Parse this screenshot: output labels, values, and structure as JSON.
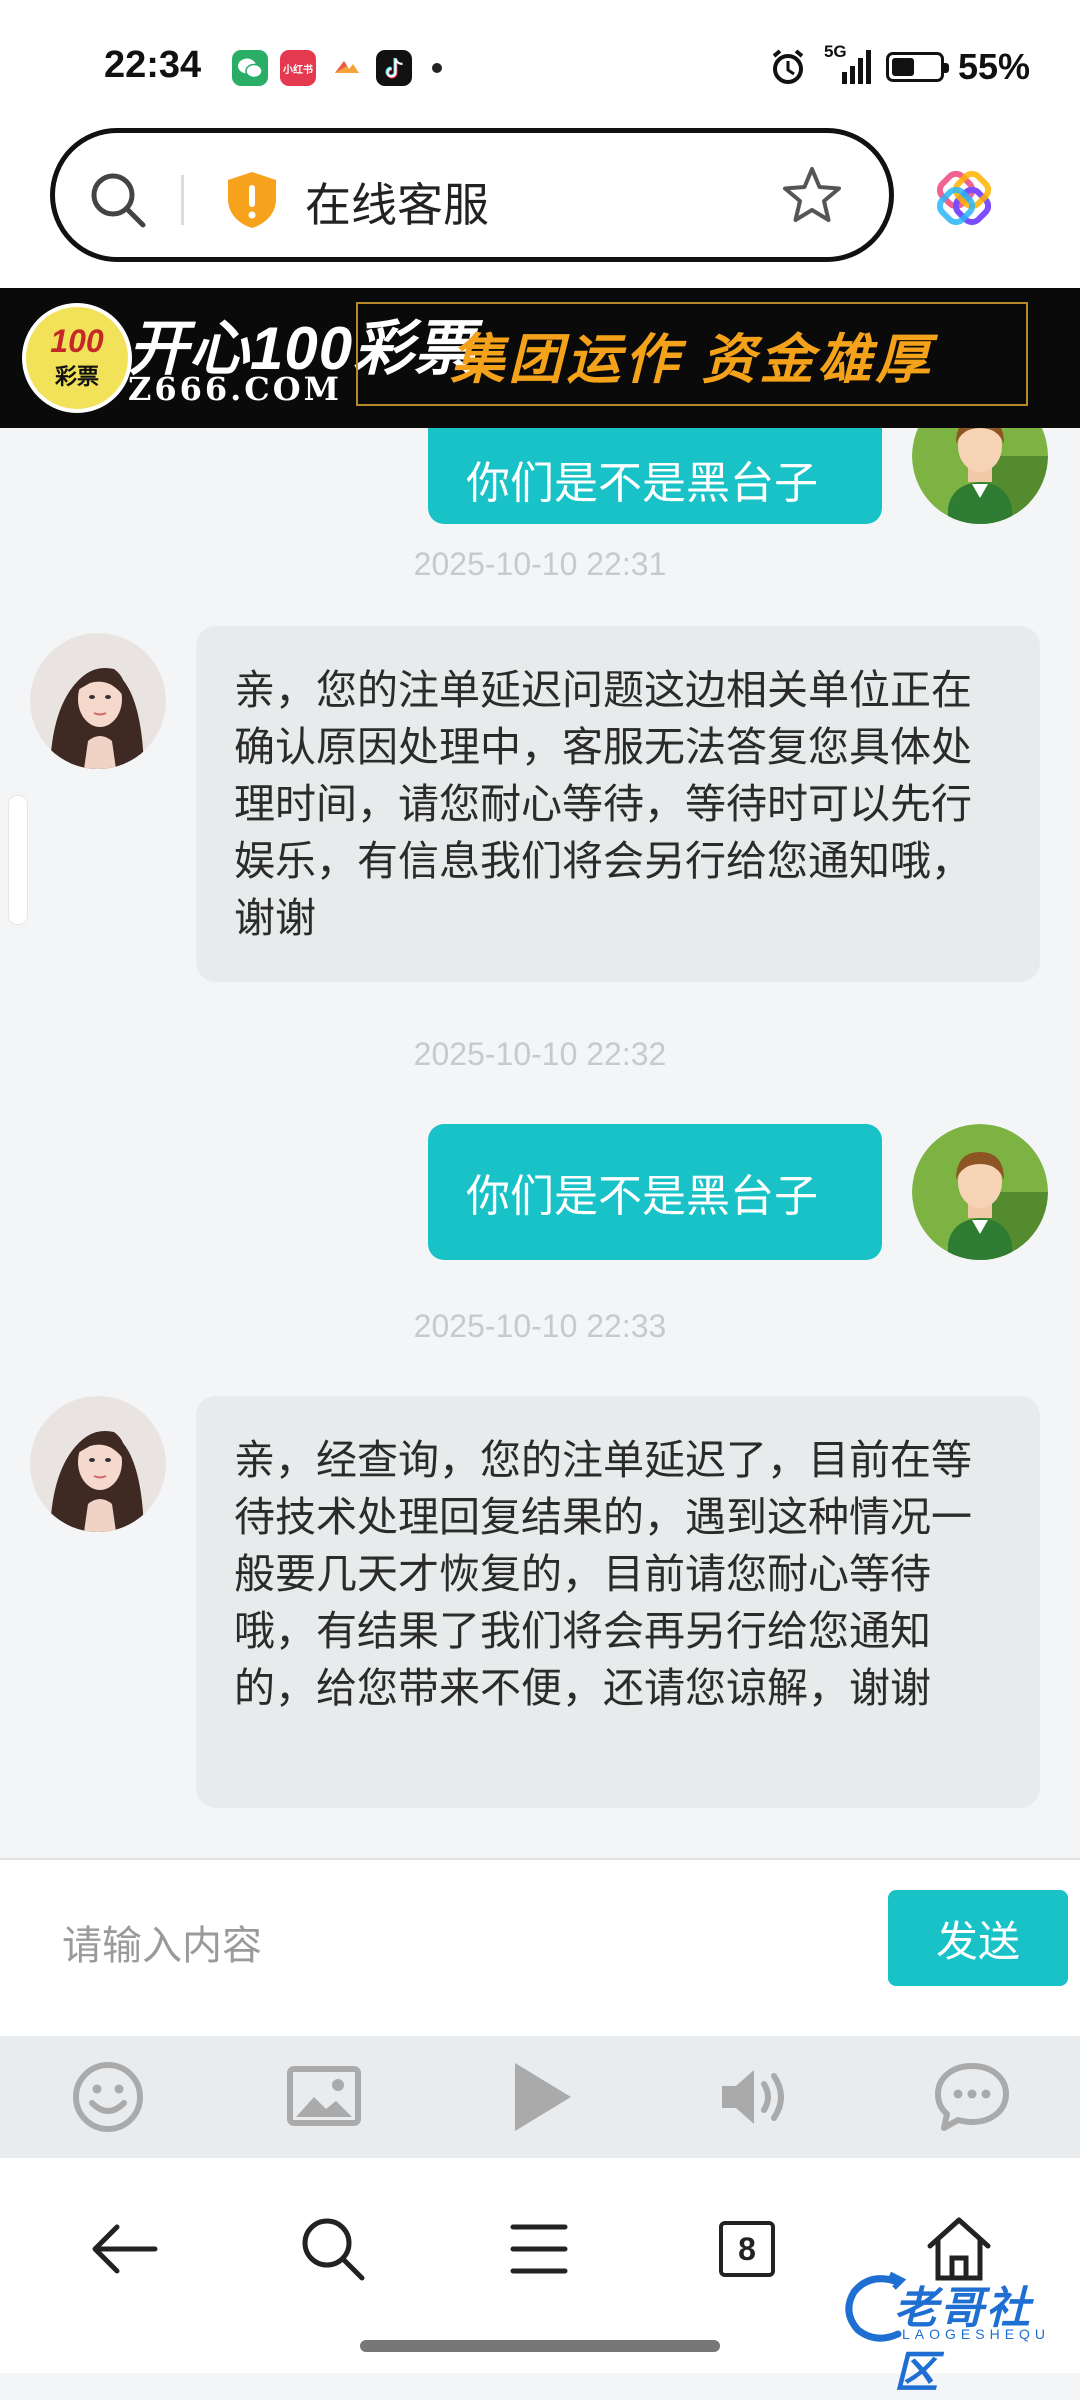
{
  "status_bar": {
    "time": "22:34",
    "apps": [
      {
        "name": "wechat-icon",
        "color": "#2aae67",
        "label": ""
      },
      {
        "name": "xiaohongshu-icon",
        "color": "#e53950",
        "label": "小红书"
      },
      {
        "name": "app-icon",
        "color": "#f6a33b",
        "label": ""
      },
      {
        "name": "tiktok-icon",
        "color": "#111111",
        "label": ""
      }
    ],
    "network": "5G",
    "battery_percent": "55%",
    "battery_level": 0.55
  },
  "address_bar": {
    "title": "在线客服"
  },
  "banner": {
    "badge_top": "100",
    "badge_bottom": "彩票",
    "logo_text": "开心100彩票",
    "domain": "Z666.COM",
    "slogan": "集团运作  资金雄厚"
  },
  "chat": {
    "messages": [
      {
        "type": "user",
        "text": "你们是不是黑台子"
      },
      {
        "type": "timestamp",
        "text": "2025-10-10 22:31"
      },
      {
        "type": "agent",
        "text": "亲，您的注单延迟问题这边相关单位正在确认原因处理中，客服无法答复您具体处理时间，请您耐心等待，等待时可以先行娱乐，有信息我们将会另行给您通知哦，谢谢"
      },
      {
        "type": "timestamp",
        "text": "2025-10-10 22:32"
      },
      {
        "type": "user",
        "text": "你们是不是黑台子"
      },
      {
        "type": "timestamp",
        "text": "2025-10-10 22:33"
      },
      {
        "type": "agent",
        "text": "亲，经查询，您的注单延迟了，目前在等待技术处理回复结果的，遇到这种情况一般要几天才恢复的，目前请您耐心等待哦，有结果了我们将会再另行给您通知的，给您带来不便，还请您谅解，谢谢"
      }
    ]
  },
  "input": {
    "placeholder": "请输入内容",
    "value": "",
    "send_label": "发送"
  },
  "tools": [
    "emoji-icon",
    "image-icon",
    "play-icon",
    "volume-icon",
    "chat-bubble-icon"
  ],
  "nav": {
    "tabs_count": "8"
  },
  "watermark": {
    "text": "老哥社区",
    "sub": "LAOGESHEQU"
  },
  "colors": {
    "accent": "#19c2c7",
    "agent_bubble": "#e8ebeb",
    "timestamp": "#c7c9cc"
  }
}
